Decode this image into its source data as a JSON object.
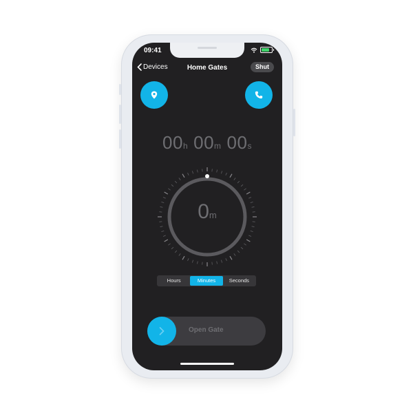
{
  "status": {
    "time": "09:41"
  },
  "nav": {
    "back_label": "Devices",
    "title": "Home Gates",
    "shut_label": "Shut"
  },
  "timer": {
    "hours": "00",
    "hours_unit": "h",
    "minutes": "00",
    "minutes_unit": "m",
    "seconds": "00",
    "seconds_unit": "s"
  },
  "dial": {
    "value": "0",
    "unit": "m"
  },
  "segments": {
    "hours": "Hours",
    "minutes": "Minutes",
    "seconds": "Seconds",
    "selected": "Minutes"
  },
  "slider": {
    "label": "Open Gate"
  },
  "icons": {
    "location": "location-pin-icon",
    "phone": "phone-icon",
    "chevron": "chevron-right-icon"
  },
  "colors": {
    "accent": "#12b4e8",
    "background": "#212022",
    "muted_text": "#6e6e72"
  }
}
